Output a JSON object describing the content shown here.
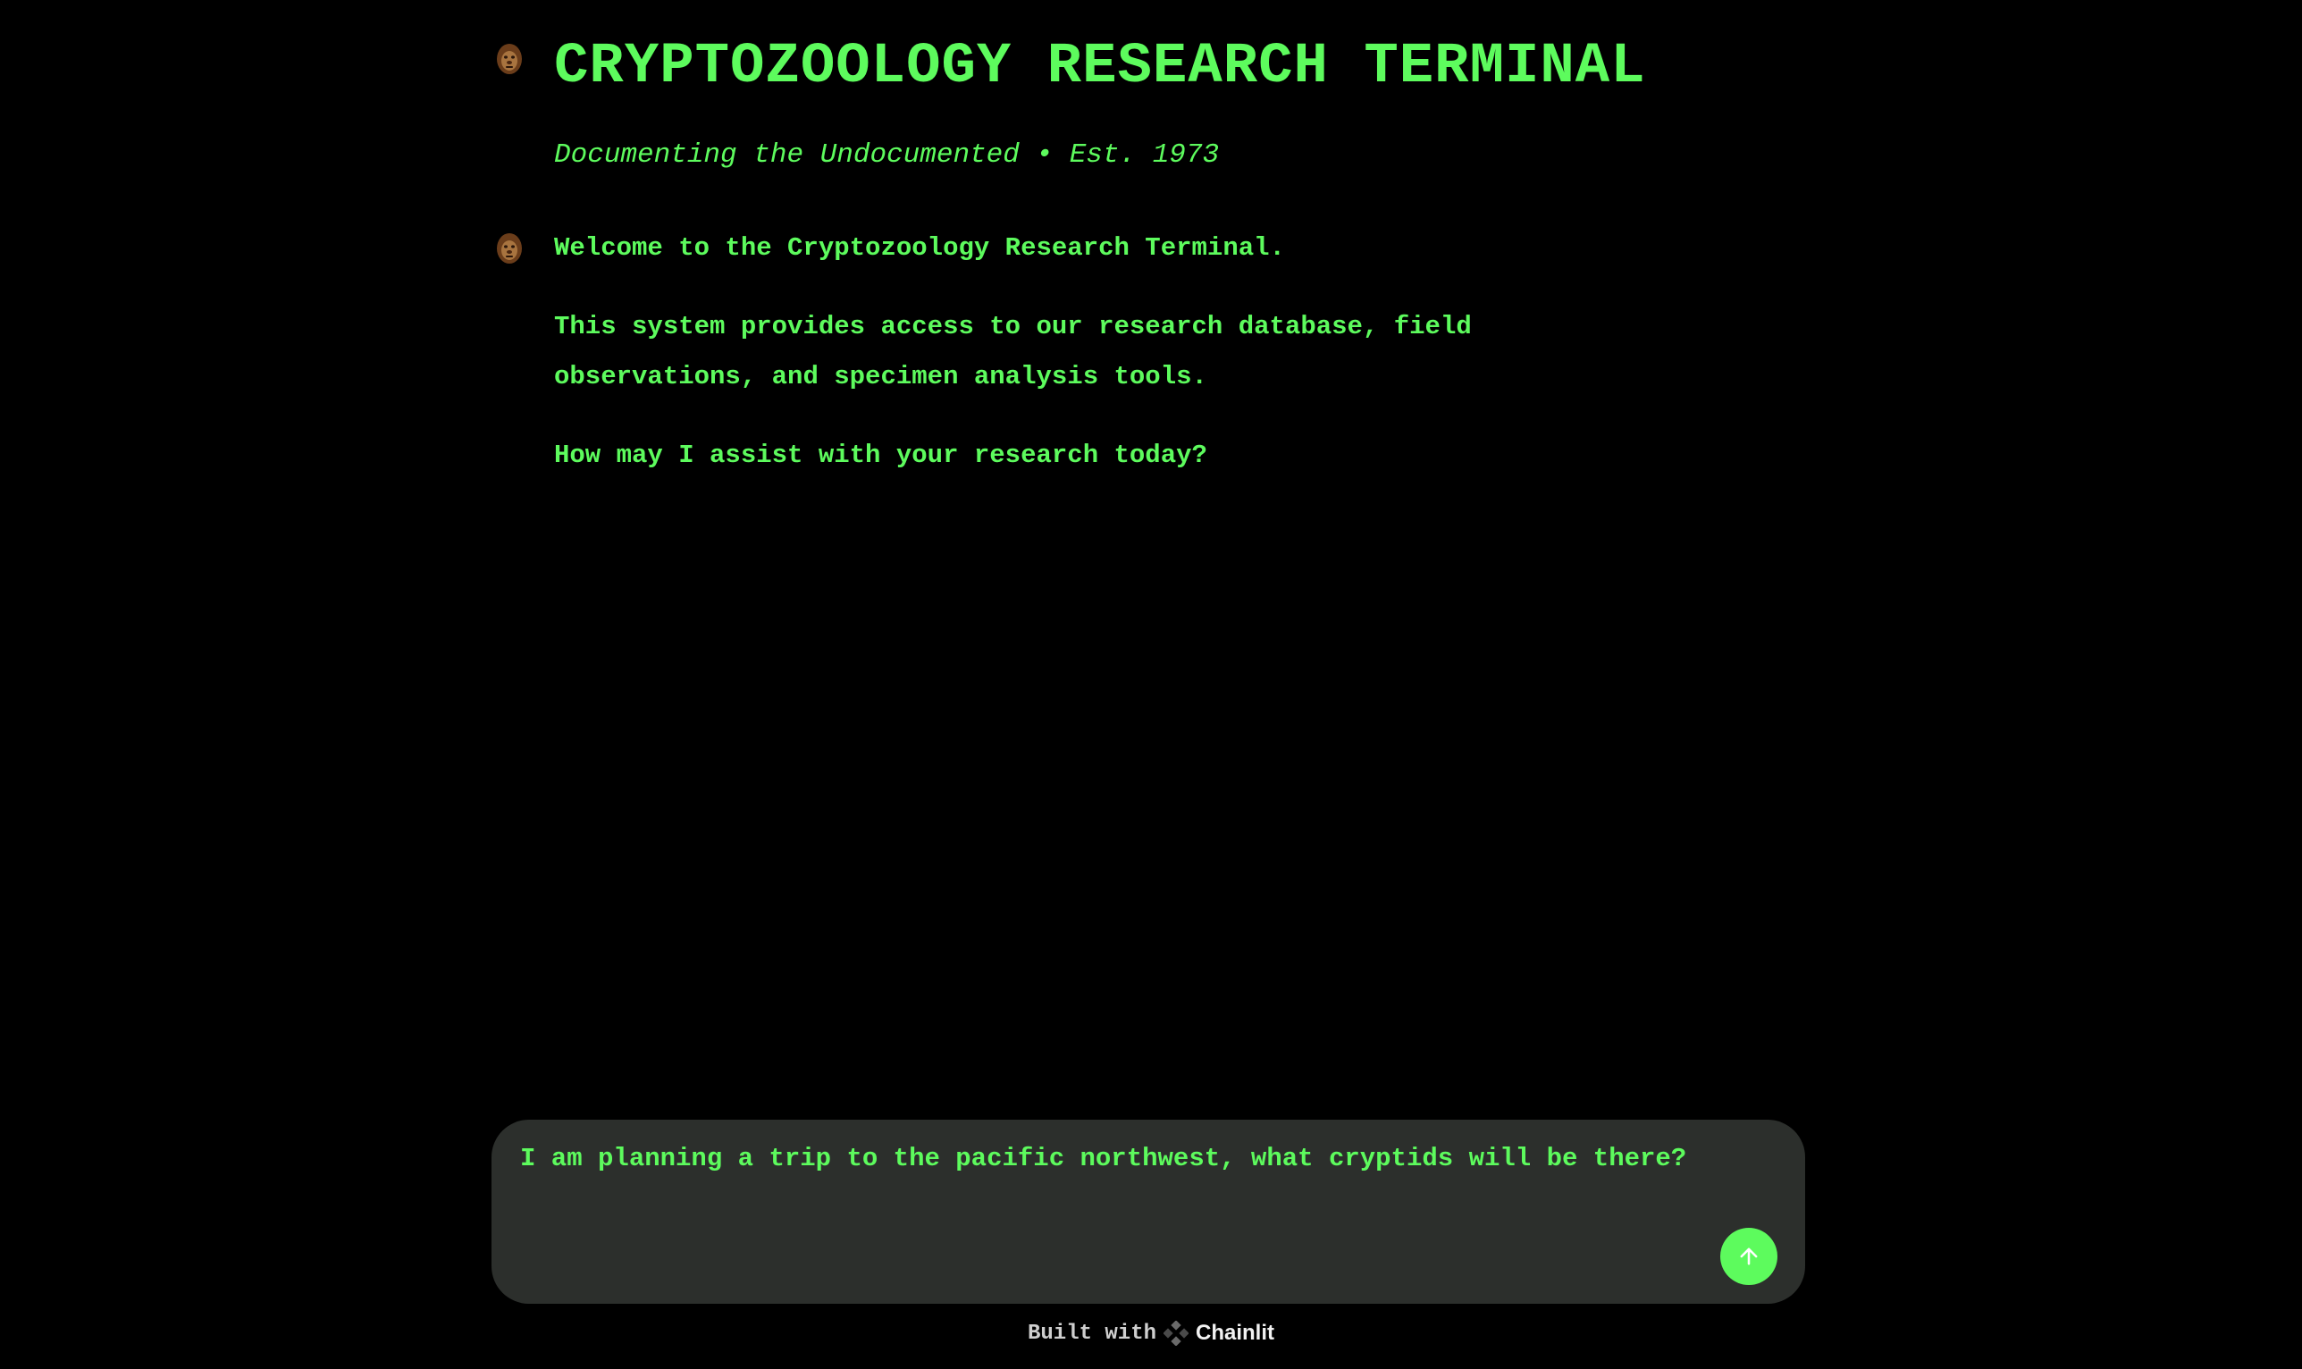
{
  "header": {
    "title": "CRYPTOZOOLOGY RESEARCH TERMINAL",
    "subtitle": "Documenting the Undocumented • Est. 1973",
    "avatar_icon": "bigfoot-avatar-icon"
  },
  "messages": [
    {
      "author_icon": "bigfoot-avatar-icon",
      "paragraphs": [
        "Welcome to the Cryptozoology Research Terminal.",
        "This system provides access to our research database, field observations, and specimen analysis tools.",
        "How may I assist with your research today?"
      ]
    }
  ],
  "composer": {
    "value": "I am planning a trip to the pacific northwest, what cryptids will be there?",
    "send_icon": "arrow-up-icon"
  },
  "footer": {
    "built_with": "Built with",
    "brand": "Chainlit",
    "brand_icon": "chainlit-logo-icon"
  },
  "colors": {
    "background": "#000000",
    "accent_green": "#5dfb5d",
    "composer_bg": "#2c2f2c",
    "avatar_brown": "#7a4a22"
  }
}
